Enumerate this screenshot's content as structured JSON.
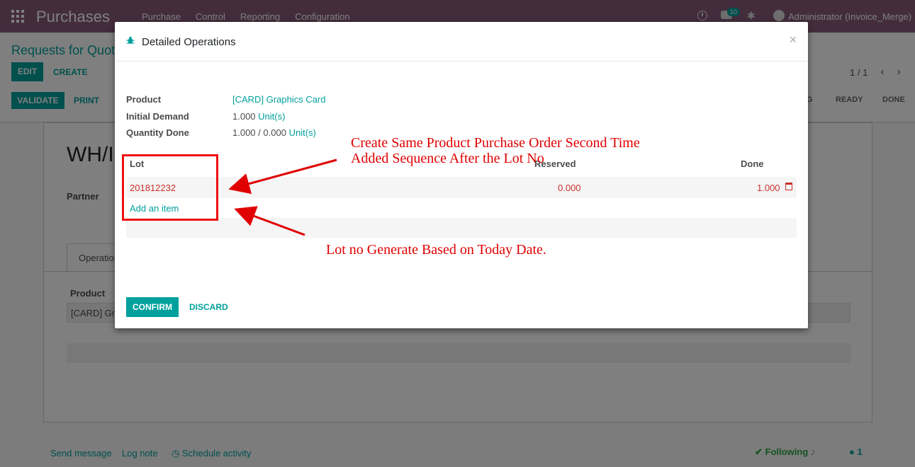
{
  "navbar": {
    "app_name": "Purchases",
    "menu": [
      "Purchase",
      "Control",
      "Reporting",
      "Configuration"
    ],
    "chat_badge": "10",
    "user": "Administrator (Invoice_Merge)"
  },
  "control_panel": {
    "breadcrumb": "Requests for Quot",
    "edit_label": "EDIT",
    "create_label": "CREATE",
    "pager": "1 / 1",
    "validate_label": "VALIDATE",
    "print_label": "PRINT",
    "stages": [
      "G",
      "READY",
      "DONE"
    ]
  },
  "sheet": {
    "name": "WH/I",
    "partner_label": "Partner",
    "tab_label": "Operation",
    "product_header": "Product",
    "row_product": "[CARD] Gra"
  },
  "chatter": {
    "send_message": "Send message",
    "log_note": "Log note",
    "schedule_activity": "Schedule activity",
    "following": "Following",
    "followers_count": "1"
  },
  "modal": {
    "title": "Detailed Operations",
    "close": "×",
    "product_label": "Product",
    "product_value": "[CARD] Graphics Card",
    "initial_demand_label": "Initial Demand",
    "initial_demand_qty": "1.000",
    "initial_demand_uom": "Unit(s)",
    "quantity_done_label": "Quantity Done",
    "quantity_done_value": "1.000",
    "quantity_done_sep": "/",
    "quantity_done_total": "0.000",
    "quantity_done_uom": "Unit(s)",
    "table": {
      "headers": {
        "lot": "Lot",
        "reserved": "Reserved",
        "done": "Done"
      },
      "row": {
        "lot": "201812232",
        "reserved": "0.000",
        "done": "1.000"
      },
      "add_item": "Add an item"
    },
    "confirm_label": "CONFIRM",
    "discard_label": "DISCARD"
  },
  "annotations": {
    "top_line1": "Create Same Product Purchase Order Second Time",
    "top_line2": "Added Sequence After the Lot No",
    "bottom": "Lot no Generate Based on Today Date.",
    "color": "#e00000"
  },
  "colors": {
    "navbar": "#875a7b",
    "primary": "#00a09d",
    "danger": "#c9302c"
  }
}
